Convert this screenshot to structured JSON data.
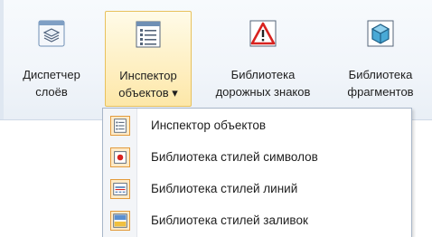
{
  "ribbon": {
    "buttons": [
      {
        "line1": "Диспетчер",
        "line2": "слоёв",
        "icon": "layers-icon"
      },
      {
        "line1": "Инспектор",
        "line2": "объектов ▾",
        "icon": "object-list-icon"
      },
      {
        "line1": "Библиотека",
        "line2": "дорожных знаков",
        "icon": "warning-sign-icon"
      },
      {
        "line1": "Библиотека",
        "line2": "фрагментов",
        "icon": "fragment-cube-icon"
      }
    ]
  },
  "menu": {
    "items": [
      {
        "label": "Инспектор объектов",
        "icon": "object-list-icon"
      },
      {
        "label": "Библиотека стилей символов",
        "icon": "symbol-style-icon"
      },
      {
        "label": "Библиотека стилей линий",
        "icon": "line-style-icon"
      },
      {
        "label": "Библиотека стилей заливок",
        "icon": "fill-style-icon"
      }
    ]
  },
  "colors": {
    "highlight_border": "#e8c15d",
    "highlight_fill": "#fde7a8",
    "menu_icon_border": "#e39b3c",
    "warning_red": "#d8221f"
  }
}
